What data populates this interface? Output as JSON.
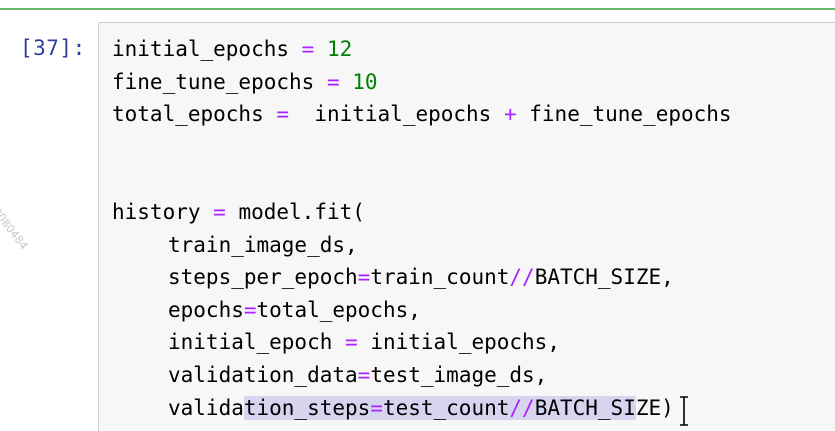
{
  "cell": {
    "prompt": "[37]:",
    "lines": [
      {
        "a": "initial_epochs ",
        "b": "=",
        "c": " ",
        "d": "12"
      },
      {
        "a": "fine_tune_epochs ",
        "b": "=",
        "c": " ",
        "d": "10"
      },
      {
        "a": "total_epochs ",
        "b": "=",
        "c": "  initial_epochs ",
        "d": "+",
        "e": " fine_tune_epochs"
      },
      {},
      {},
      {
        "a": "history ",
        "b": "=",
        "c": " model.fit("
      },
      {
        "a": "train_image_ds,"
      },
      {
        "a": "steps_per_epoch",
        "b": "=",
        "c": "train_count",
        "d": "//",
        "e": "BATCH_SIZE,"
      },
      {
        "a": "epochs",
        "b": "=",
        "c": "total_epochs,"
      },
      {
        "a": "initial_epoch ",
        "b": "=",
        "c": " initial_epochs,"
      },
      {
        "a": "validation_data",
        "b": "=",
        "c": "test_image_ds,"
      },
      {
        "a": "valida",
        "b": "tion_steps",
        "c": "=",
        "d": "test_count",
        "e": "//",
        "f": "BATCH_SI",
        "g": "ZE)"
      }
    ]
  },
  "watermark": "78080484"
}
